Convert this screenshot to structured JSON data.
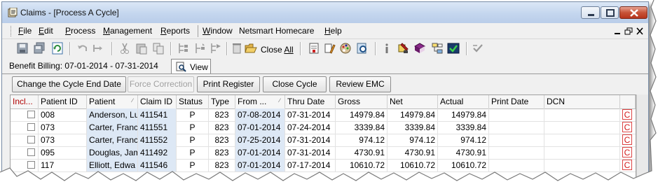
{
  "window": {
    "title": "Claims - [Process A Cycle]",
    "buttons": {
      "minimize": "minimize",
      "maximize": "maximize",
      "close": "close"
    }
  },
  "menubar": {
    "items": [
      {
        "label": "File",
        "u": "F",
        "rest": "ile"
      },
      {
        "label": "Edit",
        "u": "E",
        "rest": "dit"
      },
      {
        "label": "Process",
        "u": "P",
        "rest": "rocess"
      },
      {
        "label": "Management",
        "u": "M",
        "rest": "anagement"
      },
      {
        "label": "Reports",
        "u": "R",
        "rest": "eports"
      },
      {
        "label": "Window",
        "u": "W",
        "rest": "indow"
      },
      {
        "label": "Netsmart Homecare",
        "u": "",
        "rest": "Netsmart Homecare"
      },
      {
        "label": "Help",
        "u": "H",
        "rest": "elp"
      }
    ]
  },
  "toolbar": {
    "close_all_u": "Close ",
    "close_all_rest": "All"
  },
  "tabs": {
    "billing_label": "Benefit Billing: 07-01-2014 - 07-31-2014",
    "view_label": "View"
  },
  "actions": {
    "change_end_date": "Change the Cycle End Date",
    "force_correction": "Force Correction",
    "print_register": "Print Register",
    "close_cycle": "Close Cycle",
    "review_emc": "Review EMC"
  },
  "grid": {
    "columns": [
      "Incl...",
      "Patient ID",
      "Patient",
      "Claim ID",
      "Status",
      "Type",
      "From ...",
      "Thru Date",
      "Gross",
      "Net",
      "Actual",
      "Print Date",
      "DCN"
    ],
    "rows": [
      {
        "patient_id": "008",
        "patient": "Anderson, Lu",
        "claim_id": "411541",
        "status": "P",
        "type": "823",
        "from": "07-08-2014",
        "thru": "07-31-2014",
        "gross": "14979.84",
        "net": "14979.84",
        "actual": "14979.84",
        "flag": "C"
      },
      {
        "patient_id": "073",
        "patient": "Carter, Franc",
        "claim_id": "411551",
        "status": "P",
        "type": "823",
        "from": "07-01-2014",
        "thru": "07-24-2014",
        "gross": "3339.84",
        "net": "3339.84",
        "actual": "3339.84",
        "flag": "C"
      },
      {
        "patient_id": "073",
        "patient": "Carter, Franc",
        "claim_id": "411552",
        "status": "P",
        "type": "823",
        "from": "07-25-2014",
        "thru": "07-31-2014",
        "gross": "974.12",
        "net": "974.12",
        "actual": "974.12",
        "flag": "C"
      },
      {
        "patient_id": "095",
        "patient": "Douglas, Jam",
        "claim_id": "411492",
        "status": "P",
        "type": "823",
        "from": "07-01-2014",
        "thru": "07-31-2014",
        "gross": "4730.91",
        "net": "4730.91",
        "actual": "4730.91",
        "flag": "C"
      },
      {
        "patient_id": "117",
        "patient": "Elliott, Edwa",
        "claim_id": "411546",
        "status": "P",
        "type": "823",
        "from": "07-01-2014",
        "thru": "07-17-2014",
        "gross": "10610.72",
        "net": "10610.72",
        "actual": "10610.72",
        "flag": "C"
      }
    ]
  }
}
